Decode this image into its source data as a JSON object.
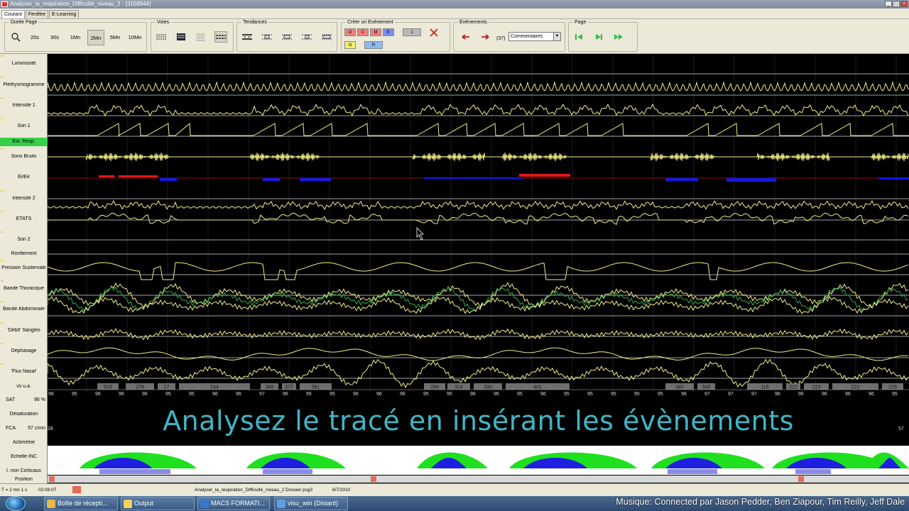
{
  "window": {
    "title": "Analyser_la_respiration_Difficulté_niveau_2 - [3158944]"
  },
  "tabs": [
    {
      "label": "Courant"
    },
    {
      "label": "Fenêtre"
    },
    {
      "label": "E-Learning"
    }
  ],
  "toolbar": {
    "duree_page": {
      "title": "Durée Page",
      "buttons": [
        "20s",
        "30s",
        "1Mn",
        "2Mn",
        "5Mn",
        "10Mn"
      ],
      "selected": "2Mn"
    },
    "voies": {
      "title": "Voies"
    },
    "tendances": {
      "title": "Tendances"
    },
    "creer_evenement": {
      "title": "Créer un Evènement",
      "buttons": [
        {
          "label": "O",
          "color": "#f08080"
        },
        {
          "label": "C",
          "color": "#f08080"
        },
        {
          "label": "M",
          "color": "#f08080"
        },
        {
          "label": "E",
          "color": "#7e8cf0"
        },
        {
          "label": "J",
          "color": "#b8b8b8"
        },
        {
          "label": "N",
          "color": "#f4ef6a"
        },
        {
          "label": "R",
          "color": "#8fb8f0"
        }
      ]
    },
    "evenements": {
      "title": "Evènements",
      "count": "(37)",
      "dropdown_value": "Commentaires"
    },
    "page": {
      "title": "Page"
    }
  },
  "channels": [
    {
      "label": "Luminosité"
    },
    {
      "label": "Plethysmogramme"
    },
    {
      "label": "Intensité 1"
    },
    {
      "label": "Son 1"
    },
    {
      "label": "Evt. Resp."
    },
    {
      "label": "Sons Bruits"
    },
    {
      "label": "Ei/Ee"
    },
    {
      "label": "Intensité 2"
    },
    {
      "label": "ETATS"
    },
    {
      "label": "Son 2"
    },
    {
      "label": "Ronflement"
    },
    {
      "label": "Pression Susternale"
    },
    {
      "label": "Bande Thoracique"
    },
    {
      "label": "Bande Abdominale"
    },
    {
      "label": "'Débit' Sangles"
    },
    {
      "label": "Déphasage"
    },
    {
      "label": "'Flux Nasal'"
    },
    {
      "label": "vs u.a."
    }
  ],
  "lower_labels": {
    "sat": {
      "label": "SAT",
      "value": "96 %"
    },
    "desaturation": "Désaturation",
    "fca": {
      "label": "FCA",
      "value": "57 c/mn"
    },
    "actimetrie": "Actimétrie",
    "echelle": "Echelle INC",
    "non_corticaux": "I. non Corticaux",
    "position": "Position"
  },
  "vs_values": [
    "529",
    "276",
    "17",
    "244",
    "386",
    "377",
    "581",
    "266",
    "314",
    "330",
    "401",
    "340",
    "343",
    "116",
    "212",
    "223",
    "221",
    "215"
  ],
  "sat_values": [
    "96",
    "95",
    "96",
    "96",
    "96",
    "95",
    "95",
    "96",
    "96",
    "97",
    "96",
    "95",
    "95",
    "96",
    "96",
    "96",
    "95",
    "95",
    "96",
    "96",
    "95",
    "96",
    "95",
    "95",
    "95",
    "95",
    "95",
    "96",
    "97",
    "97",
    "97",
    "96",
    "96",
    "96",
    "96",
    "96",
    "95",
    "96"
  ],
  "overlay_text": "Analysez le tracé en insérant les évènements",
  "fca_left": "28",
  "fca_right": "57",
  "statusbar": {
    "time": "T = 2 mn 1 s",
    "clock": "02:06:07",
    "file": "Analyser_la_respiration_Difficulté_niveau_2 Dossier psg3",
    "date": "6/7/2010"
  },
  "taskbar": [
    {
      "label": "Boîte de récepti...",
      "icon_color": "#e8b84a"
    },
    {
      "label": "Output",
      "icon_color": "#f2d25a"
    },
    {
      "label": "MACS FORMATI...",
      "icon_color": "#3a78c8"
    },
    {
      "label": "visu_win (Distant)",
      "icon_color": "#5aa0e0"
    }
  ],
  "music_credit": "Musique: Connected par Jason Pedder, Ben Ziapour, Tim Reilly, Jeff Dale",
  "colors": {
    "trace": "#eeee88",
    "green_trace": "#2fa84a",
    "accent_cyan": "#3fb6c6",
    "red_event": "#e01818",
    "blue_event": "#1818e0"
  }
}
